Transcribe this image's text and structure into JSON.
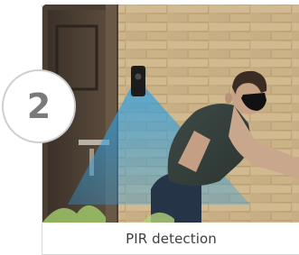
{
  "step": {
    "number": "2"
  },
  "caption": "PIR detection",
  "colors": {
    "badge_border": "#cfcfcf",
    "badge_text": "#7a7a7a",
    "pir_cone": "#2e9fe0",
    "caption_text": "#3d3d3d"
  }
}
